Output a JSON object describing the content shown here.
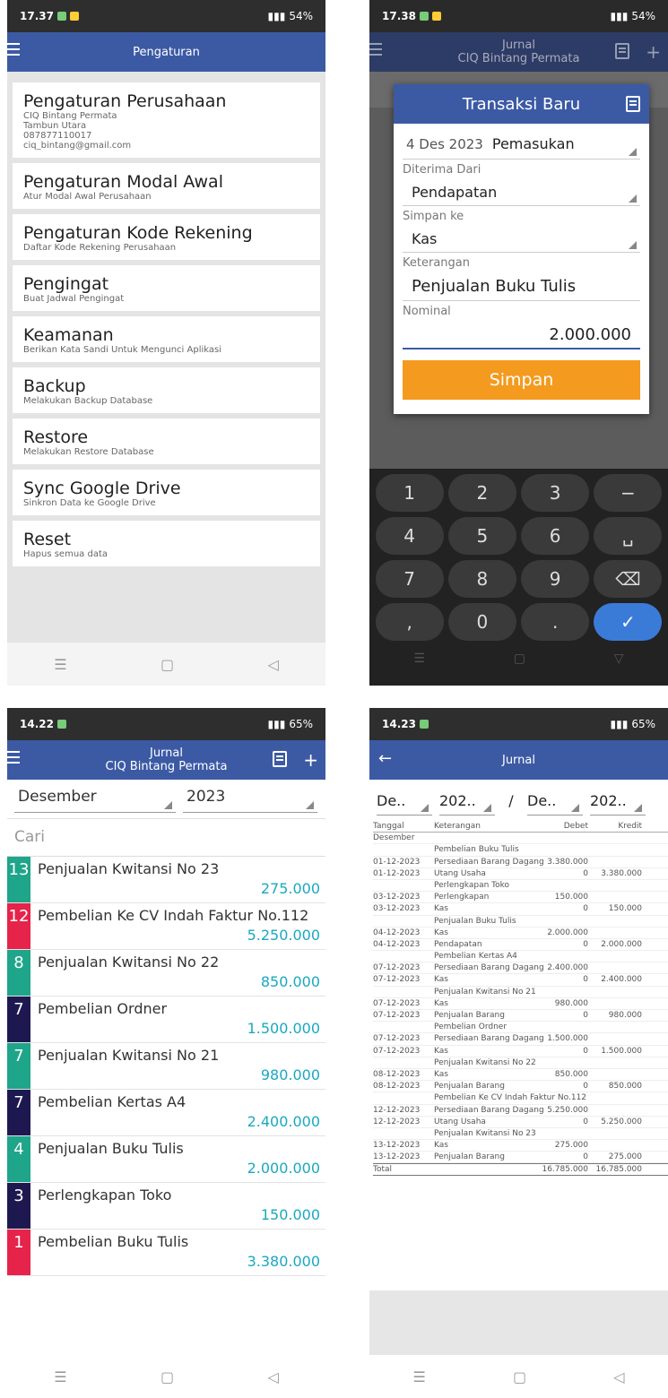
{
  "phone1": {
    "status": {
      "time": "17.37",
      "battery": "54%"
    },
    "appbar_title": "Pengaturan",
    "items": [
      {
        "title": "Pengaturan Perusahaan",
        "sub": [
          "CIQ Bintang Permata",
          "Tambun Utara",
          "087877110017",
          "ciq_bintang@gmail.com"
        ]
      },
      {
        "title": "Pengaturan Modal Awal",
        "sub": [
          "Atur Modal Awal Perusahaan"
        ]
      },
      {
        "title": "Pengaturan Kode Rekening",
        "sub": [
          "Daftar Kode Rekening Perusahaan"
        ]
      },
      {
        "title": "Pengingat",
        "sub": [
          "Buat Jadwal Pengingat"
        ]
      },
      {
        "title": "Keamanan",
        "sub": [
          "Berikan Kata Sandi Untuk Mengunci Aplikasi"
        ]
      },
      {
        "title": "Backup",
        "sub": [
          "Melakukan Backup Database"
        ]
      },
      {
        "title": "Restore",
        "sub": [
          "Melakukan Restore Database"
        ]
      },
      {
        "title": "Sync Google Drive",
        "sub": [
          "Sinkron Data ke Google Drive"
        ]
      },
      {
        "title": "Reset",
        "sub": [
          "Hapus semua data"
        ]
      }
    ]
  },
  "phone2": {
    "status": {
      "time": "17.38",
      "battery": "54%"
    },
    "appbar": {
      "title": "Jurnal",
      "subtitle": "CIQ Bintang Permata"
    },
    "dialog": {
      "title": "Transaksi Baru",
      "date": "4 Des 2023",
      "type": "Pemasukan",
      "label_from": "Diterima Dari",
      "from": "Pendapatan",
      "label_to": "Simpan ke",
      "to": "Kas",
      "label_desc": "Keterangan",
      "desc": "Penjualan Buku Tulis",
      "label_nominal": "Nominal",
      "nominal": "2.000.000",
      "save": "Simpan"
    },
    "keys": [
      [
        "1",
        "2",
        "3",
        "−"
      ],
      [
        "4",
        "5",
        "6",
        "␣"
      ],
      [
        "7",
        "8",
        "9",
        "⌫"
      ],
      [
        ",",
        "0",
        ".",
        "✓"
      ]
    ]
  },
  "phone3": {
    "status": {
      "time": "14.22",
      "battery": "65%"
    },
    "appbar": {
      "title": "Jurnal",
      "subtitle": "CIQ Bintang Permata"
    },
    "month": "Desember",
    "year": "2023",
    "search_placeholder": "Cari",
    "rows": [
      {
        "day": "13",
        "color": "teal",
        "desc": "Penjualan Kwitansi No 23",
        "amount": "275.000"
      },
      {
        "day": "12",
        "color": "red",
        "desc": "Pembelian Ke CV Indah Faktur No.112",
        "amount": "5.250.000"
      },
      {
        "day": "8",
        "color": "teal",
        "desc": "Penjualan Kwitansi No 22",
        "amount": "850.000"
      },
      {
        "day": "7",
        "color": "navy",
        "desc": "Pembelian Ordner",
        "amount": "1.500.000"
      },
      {
        "day": "7",
        "color": "teal",
        "desc": "Penjualan Kwitansi No 21",
        "amount": "980.000"
      },
      {
        "day": "7",
        "color": "navy",
        "desc": "Pembelian Kertas A4",
        "amount": "2.400.000"
      },
      {
        "day": "4",
        "color": "teal",
        "desc": "Penjualan Buku Tulis",
        "amount": "2.000.000"
      },
      {
        "day": "3",
        "color": "navy",
        "desc": "Perlengkapan Toko",
        "amount": "150.000"
      },
      {
        "day": "1",
        "color": "red",
        "desc": "Pembelian Buku Tulis",
        "amount": "3.380.000"
      }
    ]
  },
  "phone4": {
    "status": {
      "time": "14.23",
      "battery": "65%"
    },
    "appbar_title": "Jurnal",
    "filters": [
      "De..",
      "202..",
      "/",
      "De..",
      "202.."
    ],
    "headers": [
      "Tanggal",
      "Keterangan",
      "Debet",
      "Kredit"
    ],
    "rows": [
      [
        "Desember",
        "",
        "",
        ""
      ],
      [
        "",
        "Pembelian Buku Tulis",
        "",
        ""
      ],
      [
        "01-12-2023",
        "Persediaan Barang Dagang",
        "3.380.000",
        ""
      ],
      [
        "01-12-2023",
        "Utang Usaha",
        "0",
        "3.380.000"
      ],
      [
        "",
        "Perlengkapan Toko",
        "",
        ""
      ],
      [
        "03-12-2023",
        "Perlengkapan",
        "150.000",
        ""
      ],
      [
        "03-12-2023",
        "Kas",
        "0",
        "150.000"
      ],
      [
        "",
        "Penjualan Buku Tulis",
        "",
        ""
      ],
      [
        "04-12-2023",
        "Kas",
        "2.000.000",
        ""
      ],
      [
        "04-12-2023",
        "Pendapatan",
        "0",
        "2.000.000"
      ],
      [
        "",
        "Pembelian Kertas A4",
        "",
        ""
      ],
      [
        "07-12-2023",
        "Persediaan Barang Dagang",
        "2.400.000",
        ""
      ],
      [
        "07-12-2023",
        "Kas",
        "0",
        "2.400.000"
      ],
      [
        "",
        "Penjualan Kwitansi No 21",
        "",
        ""
      ],
      [
        "07-12-2023",
        "Kas",
        "980.000",
        ""
      ],
      [
        "07-12-2023",
        "Penjualan Barang",
        "0",
        "980.000"
      ],
      [
        "",
        "Pembelian Ordner",
        "",
        ""
      ],
      [
        "07-12-2023",
        "Persediaan Barang Dagang",
        "1.500.000",
        ""
      ],
      [
        "07-12-2023",
        "Kas",
        "0",
        "1.500.000"
      ],
      [
        "",
        "Penjualan Kwitansi No 22",
        "",
        ""
      ],
      [
        "08-12-2023",
        "Kas",
        "850.000",
        ""
      ],
      [
        "08-12-2023",
        "Penjualan Barang",
        "0",
        "850.000"
      ],
      [
        "",
        "Pembelian Ke CV Indah Faktur No.112",
        "",
        ""
      ],
      [
        "12-12-2023",
        "Persediaan Barang Dagang",
        "5.250.000",
        ""
      ],
      [
        "12-12-2023",
        "Utang Usaha",
        "0",
        "5.250.000"
      ],
      [
        "",
        "Penjualan Kwitansi No 23",
        "",
        ""
      ],
      [
        "13-12-2023",
        "Kas",
        "275.000",
        ""
      ],
      [
        "13-12-2023",
        "Penjualan Barang",
        "0",
        "275.000"
      ]
    ],
    "total": [
      "Total",
      "",
      "16.785.000",
      "16.785.000"
    ]
  }
}
